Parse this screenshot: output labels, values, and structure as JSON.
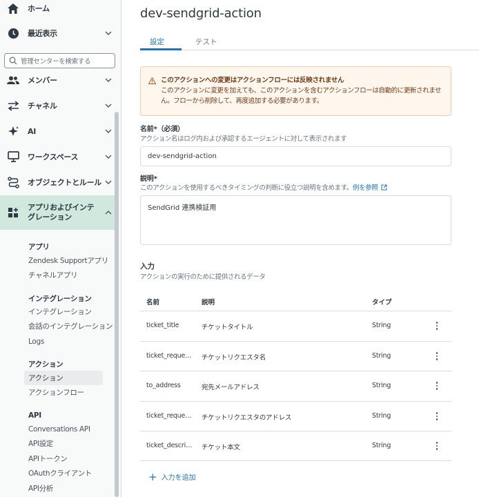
{
  "sidebar": {
    "search_placeholder": "管理センターを検索する",
    "items": [
      {
        "label": "ホーム",
        "icon": "home-icon"
      },
      {
        "label": "最近表示",
        "icon": "clock-icon"
      },
      {
        "label": "メンバー",
        "icon": "people-icon"
      },
      {
        "label": "チャネル",
        "icon": "arrows-icon"
      },
      {
        "label": "AI",
        "icon": "sparkle-icon"
      },
      {
        "label": "ワークスペース",
        "icon": "monitor-icon"
      },
      {
        "label": "オブジェクトとルール",
        "icon": "route-icon"
      },
      {
        "label": "アプリおよびインテグレーション",
        "icon": "apps-icon"
      }
    ],
    "groups": [
      {
        "heading": "アプリ",
        "items": [
          "Zendesk Supportアプリ",
          "チャネルアプリ"
        ]
      },
      {
        "heading": "インテグレーション",
        "items": [
          "インテグレーション",
          "会話のインテグレーション",
          "Logs"
        ]
      },
      {
        "heading": "アクション",
        "items": [
          "アクション",
          "アクションフロー"
        ]
      },
      {
        "heading": "API",
        "items": [
          "Conversations API",
          "API設定",
          "APIトークン",
          "OAuthクライアント",
          "API分析"
        ]
      }
    ]
  },
  "main": {
    "title": "dev-sendgrid-action",
    "tabs": [
      "設定",
      "テスト"
    ],
    "warning": {
      "title": "このアクションへの変更はアクションフローには反映されません",
      "body": "このアクションに変更を加えても、このアクションを含むアクションフローは自動的に更新されません。フローから削除して、再度追加する必要があります。"
    },
    "name_field": {
      "label": "名前*（必須）",
      "hint": "アクション名はログ内および承認するエージェントに対して表示されます",
      "value": "dev-sendgrid-action"
    },
    "desc_field": {
      "label": "説明*",
      "hint": "このアクションを使用するべきタイミングの判断に役立つ説明を含めます。",
      "link": "例を参照",
      "value": "SendGrid 連携検証用"
    },
    "inputs": {
      "title": "入力",
      "hint": "アクションの実行のために提供されるデータ",
      "headers": [
        "名前",
        "説明",
        "タイプ"
      ],
      "rows": [
        {
          "name": "ticket_title",
          "desc": "チケットタイトル",
          "type": "String"
        },
        {
          "name": "ticket_reque…",
          "desc": "チケットリクエスタ名",
          "type": "String"
        },
        {
          "name": "to_address",
          "desc": "宛先メールアドレス",
          "type": "String"
        },
        {
          "name": "ticket_reque…",
          "desc": "チケットリクエスタのアドレス",
          "type": "String"
        },
        {
          "name": "ticket_descri…",
          "desc": "チケット本文",
          "type": "String"
        }
      ],
      "add_label": "入力を追加"
    }
  },
  "colors": {
    "accent": "#1f73b7",
    "active_nav": "#d1e8df",
    "warning_bg": "#fff7ed",
    "warning_text": "#703815"
  }
}
